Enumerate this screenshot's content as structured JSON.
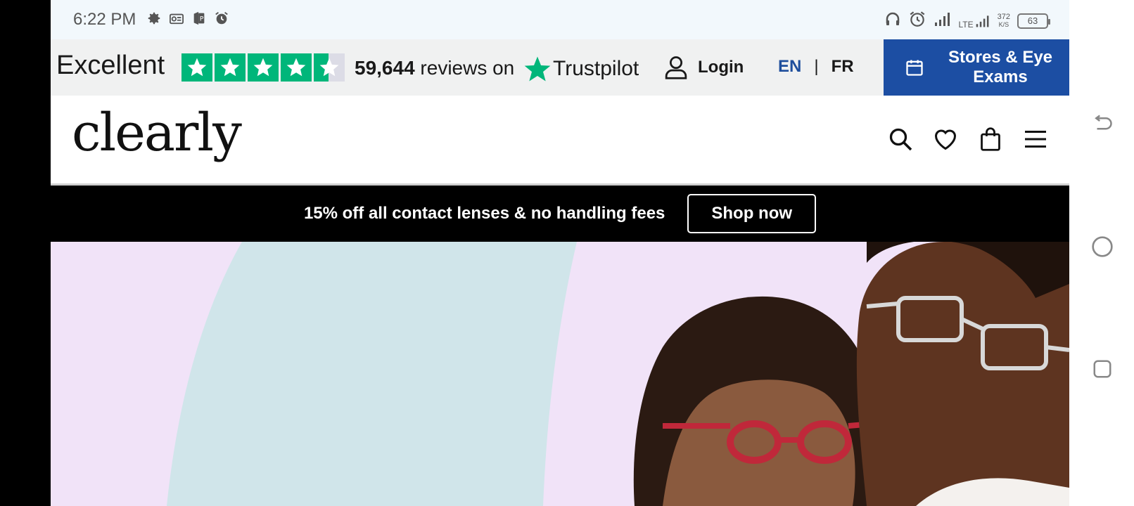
{
  "status_bar": {
    "time": "6:22 PM",
    "left_icons": [
      "settings-icon",
      "radio-icon",
      "parking-app-icon",
      "alarm-icon"
    ],
    "right_icons": [
      "headphones-icon",
      "alarm-icon",
      "signal-icon",
      "lte-signal-icon"
    ],
    "network_type": "LTE",
    "net_speed_value": "372",
    "net_speed_unit": "K/S",
    "battery": "63"
  },
  "topbar": {
    "trustpilot_rating": "Excellent",
    "stars_filled": 4.5,
    "review_count": "59,644",
    "reviews_text": "reviews on",
    "trustpilot_brand": "Trustpilot",
    "login_label": "Login",
    "lang_en": "EN",
    "lang_sep": "|",
    "lang_fr": "FR",
    "stores_label": "Stores & Eye Exams"
  },
  "header": {
    "logo": "clearly",
    "icons": [
      "search-icon",
      "heart-icon",
      "bag-icon",
      "menu-icon"
    ]
  },
  "promo": {
    "text": "15% off all contact lenses & no handling fees",
    "button": "Shop now"
  },
  "colors": {
    "trustpilot_green": "#00b67a",
    "stores_blue": "#1c4ea3",
    "lang_active": "#1e4e9c",
    "hero_bg": "#f1e3f8",
    "hero_arc": "#d0e5ea"
  },
  "navigation_bar": [
    "back-icon",
    "home-icon",
    "recents-icon"
  ]
}
